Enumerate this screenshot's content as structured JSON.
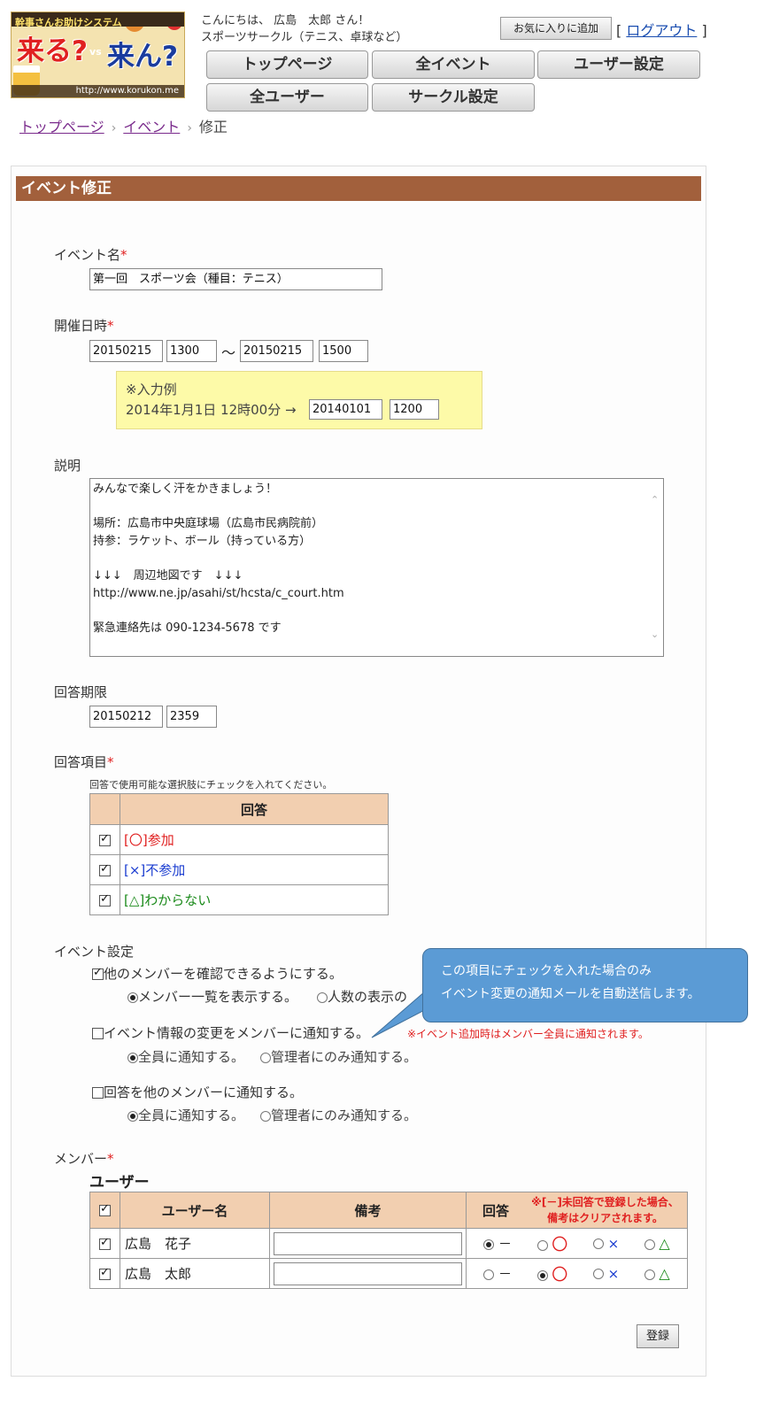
{
  "header": {
    "logo_top": "幹事さんお助けシステム",
    "logo_left": "来る?",
    "logo_vs": "vs",
    "logo_right": "来ん?",
    "logo_url": "http://www.korukon.me",
    "greeting": "こんにちは、 広島　太郎 さん！",
    "circle_name": "スポーツサークル（テニス、卓球など）",
    "favorite_label": "お気に入りに追加",
    "logout_open": "[",
    "logout_label": "ログアウト",
    "logout_close": "]"
  },
  "nav": {
    "top": "トップページ",
    "events": "全イベント",
    "user_settings": "ユーザー設定",
    "all_users": "全ユーザー",
    "circle_settings": "サークル設定"
  },
  "breadcrumb": {
    "home": "トップページ",
    "sep": "›",
    "event": "イベント",
    "current": "修正"
  },
  "panel": {
    "title": "イベント修正"
  },
  "form": {
    "required_mark": "*",
    "event_name_label": "イベント名",
    "event_name_value": "第一回　スポーツ会（種目：テニス）",
    "datetime_label": "開催日時",
    "start_date": "20150215",
    "start_time": "1300",
    "tilde": "～",
    "end_date": "20150215",
    "end_time": "1500",
    "example_title": "※入力例",
    "example_text": "2014年1月1日 12時00分 →",
    "example_date": "20140101",
    "example_time": "1200",
    "description_label": "説明",
    "description_lines": [
      "みんなで楽しく汗をかきましょう！",
      "",
      "場所：広島市中央庭球場（広島市民病院前）",
      "持参：ラケット、ボール（持っている方）",
      "",
      "↓↓↓　周辺地図です　↓↓↓",
      "http://www.ne.jp/asahi/st/hcsta/c_court.htm",
      "",
      "緊急連絡先は 090-1234-5678 です"
    ],
    "deadline_label": "回答期限",
    "deadline_date": "20150212",
    "deadline_time": "2359",
    "answer_items_label": "回答項目",
    "answer_items_hint": "回答で使用可能な選択肢にチェックを入れてください。",
    "answer_header": "回答",
    "answer_options": [
      {
        "label": "[〇]参加",
        "color": "#e02020",
        "checked": true
      },
      {
        "label": "[×]不参加",
        "color": "#1a3cd0",
        "checked": true
      },
      {
        "label": "[△]わからない",
        "color": "#1a8a1a",
        "checked": true
      }
    ],
    "event_settings_label": "イベント設定",
    "setting1": "他のメンバーを確認できるようにする。",
    "setting1_opt1": "メンバー一覧を表示する。",
    "setting1_opt2": "人数の表示の",
    "setting2": "イベント情報の変更をメンバーに通知する。",
    "setting2_note": "※イベント追加時はメンバー全員に通知されます。",
    "setting2_opt1": "全員に通知する。",
    "setting2_opt2": "管理者にのみ通知する。",
    "setting3": "回答を他のメンバーに通知する。",
    "setting3_opt1": "全員に通知する。",
    "setting3_opt2": "管理者にのみ通知する。",
    "members_label": "メンバー",
    "users_heading": "ユーザー",
    "col_username": "ユーザー名",
    "col_note": "備考",
    "col_answer": "回答",
    "col_answer_note1": "※[－]未回答で登録した場合、",
    "col_answer_note2": "備考はクリアされます。",
    "sym_none": "－",
    "sym_yes": "〇",
    "sym_no": "×",
    "sym_maybe": "△",
    "members": [
      {
        "name": "広島　花子",
        "note": "",
        "answer": "none"
      },
      {
        "name": "広島　太郎",
        "note": "",
        "answer": "yes"
      }
    ],
    "submit_label": "登録"
  },
  "callout": {
    "line1": "この項目にチェックを入れた場合のみ",
    "line2": "イベント変更の通知メールを自動送信します。"
  }
}
